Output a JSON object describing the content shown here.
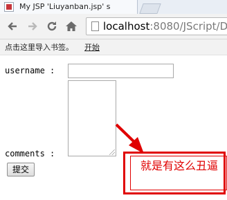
{
  "tab": {
    "title": "My JSP 'Liuyanban.jsp' s"
  },
  "toolbar": {
    "back_icon": "arrow-left-icon",
    "forward_icon": "arrow-right-icon",
    "reload_icon": "reload-icon",
    "home_icon": "home-icon",
    "url_host": "localhost",
    "url_path": ":8080/JScript/D"
  },
  "bookmarks": {
    "hint": "点击这里导入书签。",
    "start_link": "开始"
  },
  "form": {
    "username_label": "username :",
    "comments_label": "comments :",
    "submit_label": "提交"
  },
  "annotation": {
    "text": "就是有这么丑逼",
    "color": "#e00000"
  }
}
